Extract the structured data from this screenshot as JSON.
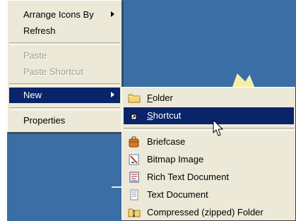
{
  "context_menu": {
    "arrange_icons_by": "Arrange Icons By",
    "refresh": "Refresh",
    "paste": "Paste",
    "paste_shortcut": "Paste Shortcut",
    "new": "New",
    "properties": "Properties"
  },
  "new_submenu": {
    "folder": {
      "accel": "F",
      "rest": "older"
    },
    "shortcut": {
      "accel": "S",
      "rest": "hortcut"
    },
    "briefcase": "Briefcase",
    "bitmap_image": "Bitmap Image",
    "rich_text_document": "Rich Text Document",
    "text_document": "Text Document",
    "compressed_folder": "Compressed (zipped) Folder"
  },
  "colors": {
    "desktop": "#3a6ea5",
    "menu_bg": "#ece9d8",
    "highlight": "#0a246a"
  }
}
